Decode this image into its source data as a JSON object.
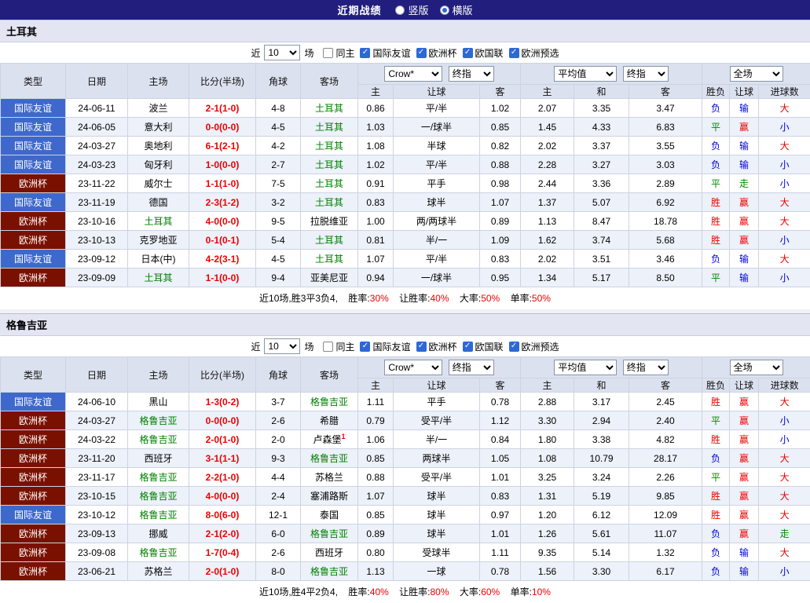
{
  "topbar": {
    "title": "近期战绩",
    "layout_options": [
      {
        "label": "竖版",
        "selected": false
      },
      {
        "label": "横版",
        "selected": true
      }
    ]
  },
  "colors": {
    "topbar_bg": "#211E7E",
    "accent": "#2D68D8",
    "league_friendly": "#3E68CC",
    "league_eurocup": "#7A1100",
    "team_highlight": "#008000",
    "score": "#EE0000",
    "red": "#EE0000",
    "green": "#008800",
    "blue": "#0000DD",
    "header_bg": "#DCE1EF",
    "row_alt_bg": "#ECF1FA",
    "section_header_bg": "#E3E5F3"
  },
  "sections": [
    {
      "team": "土耳其",
      "filter": {
        "recent_label": "近",
        "recent_count": "10",
        "matches_label": "场",
        "options": [
          {
            "label": "同主",
            "checked": false
          },
          {
            "label": "国际友谊",
            "checked": true
          },
          {
            "label": "欧洲杯",
            "checked": true
          },
          {
            "label": "欧国联",
            "checked": true
          },
          {
            "label": "欧洲预选",
            "checked": true
          }
        ]
      },
      "table": {
        "headers": [
          "类型",
          "日期",
          "主场",
          "比分(半场)",
          "角球",
          "客场"
        ],
        "bookmaker": "Crow*",
        "final_label_1": "终指",
        "average_label": "平均值",
        "final_label_2": "终指",
        "scope_label": "全场",
        "sub": [
          "主",
          "让球",
          "客",
          "主",
          "和",
          "客",
          "胜负",
          "让球",
          "进球数"
        ]
      },
      "rows": [
        {
          "league": "国际友谊",
          "league_key": "friendly",
          "date": "24-06-11",
          "home": "波兰",
          "home_hl": false,
          "score": "2-1(1-0)",
          "corner": "4-8",
          "away": "土耳其",
          "away_hl": true,
          "ah": [
            "0.86",
            "平/半",
            "1.02"
          ],
          "eu": [
            "2.07",
            "3.35",
            "3.47"
          ],
          "res": [
            {
              "t": "负",
              "c": "blue"
            },
            {
              "t": "输",
              "c": "blue"
            },
            {
              "t": "大",
              "c": "red"
            }
          ]
        },
        {
          "league": "国际友谊",
          "league_key": "friendly",
          "date": "24-06-05",
          "home": "意大利",
          "home_hl": false,
          "score": "0-0(0-0)",
          "corner": "4-5",
          "away": "土耳其",
          "away_hl": true,
          "ah": [
            "1.03",
            "一/球半",
            "0.85"
          ],
          "eu": [
            "1.45",
            "4.33",
            "6.83"
          ],
          "res": [
            {
              "t": "平",
              "c": "green"
            },
            {
              "t": "赢",
              "c": "red"
            },
            {
              "t": "小",
              "c": "blue"
            }
          ]
        },
        {
          "league": "国际友谊",
          "league_key": "friendly",
          "date": "24-03-27",
          "home": "奥地利",
          "home_hl": false,
          "score": "6-1(2-1)",
          "corner": "4-2",
          "away": "土耳其",
          "away_hl": true,
          "ah": [
            "1.08",
            "半球",
            "0.82"
          ],
          "eu": [
            "2.02",
            "3.37",
            "3.55"
          ],
          "res": [
            {
              "t": "负",
              "c": "blue"
            },
            {
              "t": "输",
              "c": "blue"
            },
            {
              "t": "大",
              "c": "red"
            }
          ]
        },
        {
          "league": "国际友谊",
          "league_key": "friendly",
          "date": "24-03-23",
          "home": "匈牙利",
          "home_hl": false,
          "score": "1-0(0-0)",
          "corner": "2-7",
          "away": "土耳其",
          "away_hl": true,
          "ah": [
            "1.02",
            "平/半",
            "0.88"
          ],
          "eu": [
            "2.28",
            "3.27",
            "3.03"
          ],
          "res": [
            {
              "t": "负",
              "c": "blue"
            },
            {
              "t": "输",
              "c": "blue"
            },
            {
              "t": "小",
              "c": "blue"
            }
          ]
        },
        {
          "league": "欧洲杯",
          "league_key": "eurocup",
          "date": "23-11-22",
          "home": "威尔士",
          "home_hl": false,
          "score": "1-1(1-0)",
          "corner": "7-5",
          "away": "土耳其",
          "away_hl": true,
          "ah": [
            "0.91",
            "平手",
            "0.98"
          ],
          "eu": [
            "2.44",
            "3.36",
            "2.89"
          ],
          "res": [
            {
              "t": "平",
              "c": "green"
            },
            {
              "t": "走",
              "c": "green"
            },
            {
              "t": "小",
              "c": "blue"
            }
          ]
        },
        {
          "league": "国际友谊",
          "league_key": "friendly",
          "date": "23-11-19",
          "home": "德国",
          "home_hl": false,
          "score": "2-3(1-2)",
          "corner": "3-2",
          "away": "土耳其",
          "away_hl": true,
          "ah": [
            "0.83",
            "球半",
            "1.07"
          ],
          "eu": [
            "1.37",
            "5.07",
            "6.92"
          ],
          "res": [
            {
              "t": "胜",
              "c": "red"
            },
            {
              "t": "赢",
              "c": "red"
            },
            {
              "t": "大",
              "c": "red"
            }
          ]
        },
        {
          "league": "欧洲杯",
          "league_key": "eurocup",
          "date": "23-10-16",
          "home": "土耳其",
          "home_hl": true,
          "score": "4-0(0-0)",
          "corner": "9-5",
          "away": "拉脱维亚",
          "away_hl": false,
          "ah": [
            "1.00",
            "两/两球半",
            "0.89"
          ],
          "eu": [
            "1.13",
            "8.47",
            "18.78"
          ],
          "res": [
            {
              "t": "胜",
              "c": "red"
            },
            {
              "t": "赢",
              "c": "red"
            },
            {
              "t": "大",
              "c": "red"
            }
          ]
        },
        {
          "league": "欧洲杯",
          "league_key": "eurocup",
          "date": "23-10-13",
          "home": "克罗地亚",
          "home_hl": false,
          "score": "0-1(0-1)",
          "corner": "5-4",
          "away": "土耳其",
          "away_hl": true,
          "ah": [
            "0.81",
            "半/一",
            "1.09"
          ],
          "eu": [
            "1.62",
            "3.74",
            "5.68"
          ],
          "res": [
            {
              "t": "胜",
              "c": "red"
            },
            {
              "t": "赢",
              "c": "red"
            },
            {
              "t": "小",
              "c": "blue"
            }
          ]
        },
        {
          "league": "国际友谊",
          "league_key": "friendly",
          "date": "23-09-12",
          "home": "日本(中)",
          "home_hl": false,
          "score": "4-2(3-1)",
          "corner": "4-5",
          "away": "土耳其",
          "away_hl": true,
          "ah": [
            "1.07",
            "平/半",
            "0.83"
          ],
          "eu": [
            "2.02",
            "3.51",
            "3.46"
          ],
          "res": [
            {
              "t": "负",
              "c": "blue"
            },
            {
              "t": "输",
              "c": "blue"
            },
            {
              "t": "大",
              "c": "red"
            }
          ]
        },
        {
          "league": "欧洲杯",
          "league_key": "eurocup",
          "date": "23-09-09",
          "home": "土耳其",
          "home_hl": true,
          "score": "1-1(0-0)",
          "corner": "9-4",
          "away": "亚美尼亚",
          "away_hl": false,
          "ah": [
            "0.94",
            "一/球半",
            "0.95"
          ],
          "eu": [
            "1.34",
            "5.17",
            "8.50"
          ],
          "res": [
            {
              "t": "平",
              "c": "green"
            },
            {
              "t": "输",
              "c": "blue"
            },
            {
              "t": "小",
              "c": "blue"
            }
          ]
        }
      ],
      "summary": {
        "prefix": "近10场,胜3平3负4,",
        "stats": [
          {
            "label": "胜率:",
            "value": "30%"
          },
          {
            "label": "让胜率:",
            "value": "40%"
          },
          {
            "label": "大率:",
            "value": "50%"
          },
          {
            "label": "单率:",
            "value": "50%"
          }
        ]
      }
    },
    {
      "team": "格鲁吉亚",
      "filter": {
        "recent_label": "近",
        "recent_count": "10",
        "matches_label": "场",
        "options": [
          {
            "label": "同主",
            "checked": false
          },
          {
            "label": "国际友谊",
            "checked": true
          },
          {
            "label": "欧洲杯",
            "checked": true
          },
          {
            "label": "欧国联",
            "checked": true
          },
          {
            "label": "欧洲预选",
            "checked": true
          }
        ]
      },
      "table": {
        "headers": [
          "类型",
          "日期",
          "主场",
          "比分(半场)",
          "角球",
          "客场"
        ],
        "bookmaker": "Crow*",
        "final_label_1": "终指",
        "average_label": "平均值",
        "final_label_2": "终指",
        "scope_label": "全场",
        "sub": [
          "主",
          "让球",
          "客",
          "主",
          "和",
          "客",
          "胜负",
          "让球",
          "进球数"
        ]
      },
      "rows": [
        {
          "league": "国际友谊",
          "league_key": "friendly",
          "date": "24-06-10",
          "home": "黑山",
          "home_hl": false,
          "score": "1-3(0-2)",
          "corner": "3-7",
          "away": "格鲁吉亚",
          "away_hl": true,
          "ah": [
            "1.11",
            "平手",
            "0.78"
          ],
          "eu": [
            "2.88",
            "3.17",
            "2.45"
          ],
          "res": [
            {
              "t": "胜",
              "c": "red"
            },
            {
              "t": "赢",
              "c": "red"
            },
            {
              "t": "大",
              "c": "red"
            }
          ]
        },
        {
          "league": "欧洲杯",
          "league_key": "eurocup",
          "date": "24-03-27",
          "home": "格鲁吉亚",
          "home_hl": true,
          "score": "0-0(0-0)",
          "corner": "2-6",
          "away": "希腊",
          "away_hl": false,
          "ah": [
            "0.79",
            "受平/半",
            "1.12"
          ],
          "eu": [
            "3.30",
            "2.94",
            "2.40"
          ],
          "res": [
            {
              "t": "平",
              "c": "green"
            },
            {
              "t": "赢",
              "c": "red"
            },
            {
              "t": "小",
              "c": "blue"
            }
          ]
        },
        {
          "league": "欧洲杯",
          "league_key": "eurocup",
          "date": "24-03-22",
          "home": "格鲁吉亚",
          "home_hl": true,
          "score": "2-0(1-0)",
          "corner": "2-0",
          "away": "卢森堡",
          "away_hl": false,
          "away_mark": "1",
          "ah": [
            "1.06",
            "半/一",
            "0.84"
          ],
          "eu": [
            "1.80",
            "3.38",
            "4.82"
          ],
          "res": [
            {
              "t": "胜",
              "c": "red"
            },
            {
              "t": "赢",
              "c": "red"
            },
            {
              "t": "小",
              "c": "blue"
            }
          ]
        },
        {
          "league": "欧洲杯",
          "league_key": "eurocup",
          "date": "23-11-20",
          "home": "西班牙",
          "home_hl": false,
          "score": "3-1(1-1)",
          "corner": "9-3",
          "away": "格鲁吉亚",
          "away_hl": true,
          "ah": [
            "0.85",
            "两球半",
            "1.05"
          ],
          "eu": [
            "1.08",
            "10.79",
            "28.17"
          ],
          "res": [
            {
              "t": "负",
              "c": "blue"
            },
            {
              "t": "赢",
              "c": "red"
            },
            {
              "t": "大",
              "c": "red"
            }
          ]
        },
        {
          "league": "欧洲杯",
          "league_key": "eurocup",
          "date": "23-11-17",
          "home": "格鲁吉亚",
          "home_hl": true,
          "score": "2-2(1-0)",
          "corner": "4-4",
          "away": "苏格兰",
          "away_hl": false,
          "ah": [
            "0.88",
            "受平/半",
            "1.01"
          ],
          "eu": [
            "3.25",
            "3.24",
            "2.26"
          ],
          "res": [
            {
              "t": "平",
              "c": "green"
            },
            {
              "t": "赢",
              "c": "red"
            },
            {
              "t": "大",
              "c": "red"
            }
          ]
        },
        {
          "league": "欧洲杯",
          "league_key": "eurocup",
          "date": "23-10-15",
          "home": "格鲁吉亚",
          "home_hl": true,
          "score": "4-0(0-0)",
          "corner": "2-4",
          "away": "塞浦路斯",
          "away_hl": false,
          "ah": [
            "1.07",
            "球半",
            "0.83"
          ],
          "eu": [
            "1.31",
            "5.19",
            "9.85"
          ],
          "res": [
            {
              "t": "胜",
              "c": "red"
            },
            {
              "t": "赢",
              "c": "red"
            },
            {
              "t": "大",
              "c": "red"
            }
          ]
        },
        {
          "league": "国际友谊",
          "league_key": "friendly",
          "date": "23-10-12",
          "home": "格鲁吉亚",
          "home_hl": true,
          "score": "8-0(6-0)",
          "corner": "12-1",
          "away": "泰国",
          "away_hl": false,
          "ah": [
            "0.85",
            "球半",
            "0.97"
          ],
          "eu": [
            "1.20",
            "6.12",
            "12.09"
          ],
          "res": [
            {
              "t": "胜",
              "c": "red"
            },
            {
              "t": "赢",
              "c": "red"
            },
            {
              "t": "大",
              "c": "red"
            }
          ]
        },
        {
          "league": "欧洲杯",
          "league_key": "eurocup",
          "date": "23-09-13",
          "home": "挪威",
          "home_hl": false,
          "score": "2-1(2-0)",
          "corner": "6-0",
          "away": "格鲁吉亚",
          "away_hl": true,
          "ah": [
            "0.89",
            "球半",
            "1.01"
          ],
          "eu": [
            "1.26",
            "5.61",
            "11.07"
          ],
          "res": [
            {
              "t": "负",
              "c": "blue"
            },
            {
              "t": "赢",
              "c": "red"
            },
            {
              "t": "走",
              "c": "green"
            }
          ]
        },
        {
          "league": "欧洲杯",
          "league_key": "eurocup",
          "date": "23-09-08",
          "home": "格鲁吉亚",
          "home_hl": true,
          "score": "1-7(0-4)",
          "corner": "2-6",
          "away": "西班牙",
          "away_hl": false,
          "ah": [
            "0.80",
            "受球半",
            "1.11"
          ],
          "eu": [
            "9.35",
            "5.14",
            "1.32"
          ],
          "res": [
            {
              "t": "负",
              "c": "blue"
            },
            {
              "t": "输",
              "c": "blue"
            },
            {
              "t": "大",
              "c": "red"
            }
          ]
        },
        {
          "league": "欧洲杯",
          "league_key": "eurocup",
          "date": "23-06-21",
          "home": "苏格兰",
          "home_hl": false,
          "score": "2-0(1-0)",
          "corner": "8-0",
          "away": "格鲁吉亚",
          "away_hl": true,
          "ah": [
            "1.13",
            "一球",
            "0.78"
          ],
          "eu": [
            "1.56",
            "3.30",
            "6.17"
          ],
          "res": [
            {
              "t": "负",
              "c": "blue"
            },
            {
              "t": "输",
              "c": "blue"
            },
            {
              "t": "小",
              "c": "blue"
            }
          ]
        }
      ],
      "summary": {
        "prefix": "近10场,胜4平2负4,",
        "stats": [
          {
            "label": "胜率:",
            "value": "40%"
          },
          {
            "label": "让胜率:",
            "value": "80%"
          },
          {
            "label": "大率:",
            "value": "60%"
          },
          {
            "label": "单率:",
            "value": "10%"
          }
        ]
      }
    }
  ]
}
